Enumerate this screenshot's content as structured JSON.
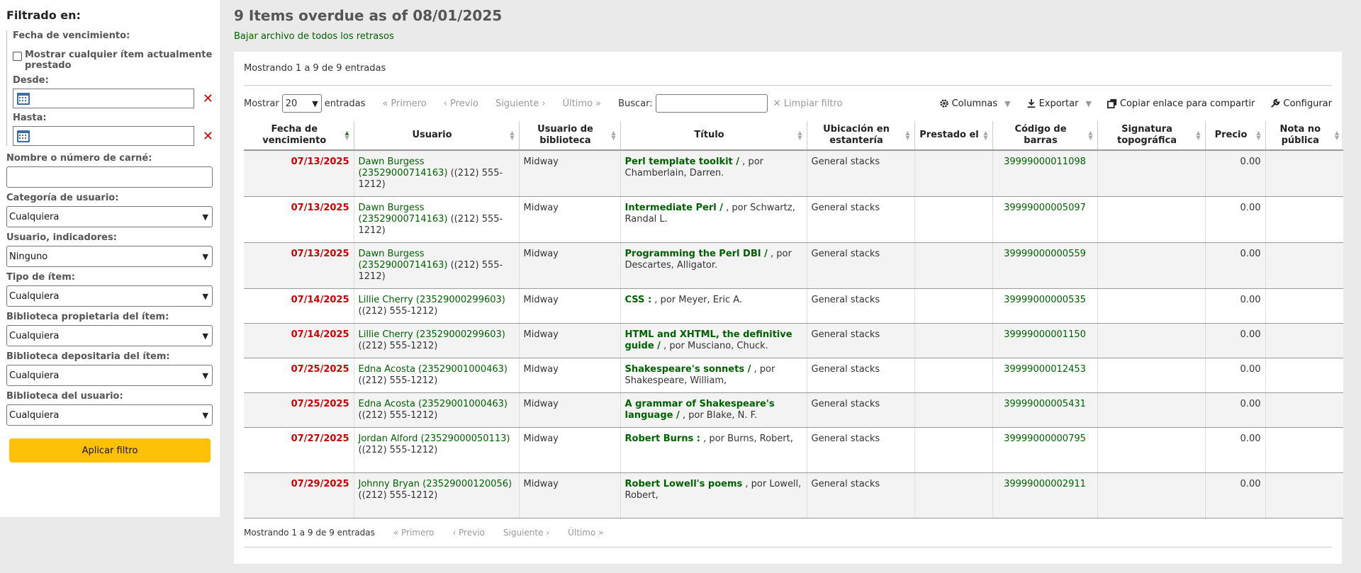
{
  "sidebar": {
    "heading": "Filtrado en:",
    "due_date_label": "Fecha de vencimiento:",
    "show_any_label": "Mostrar cualquier ítem actualmente prestado",
    "from_label": "Desde:",
    "to_label": "Hasta:",
    "patron_label": "Nombre o número de carné:",
    "patron_category_label": "Categoría de usuario:",
    "patron_category_value": "Cualquiera",
    "patron_flags_label": "Usuario, indicadores:",
    "patron_flags_value": "Ninguno",
    "item_type_label": "Tipo de ítem:",
    "item_type_value": "Cualquiera",
    "home_library_label": "Biblioteca propietaria del ítem:",
    "home_library_value": "Cualquiera",
    "holding_library_label": "Biblioteca depositaria del ítem:",
    "holding_library_value": "Cualquiera",
    "patron_library_label": "Biblioteca del usuario:",
    "patron_library_value": "Cualquiera",
    "apply_button": "Aplicar filtro"
  },
  "main": {
    "title": "9 Items overdue as of 08/01/2025",
    "download_link": "Bajar archivo de todos los retrasos",
    "info_top": "Mostrando 1 a 9 de 9 entradas",
    "show_label": "Mostrar",
    "page_size": "20",
    "entries_label": "entradas",
    "first": "« Primero",
    "prev": "‹ Previo",
    "next": "Siguiente ›",
    "last": "Último »",
    "search_label": "Buscar:",
    "clear_filter": "Limpiar filtro",
    "columns_btn": "Columnas",
    "export_btn": "Exportar",
    "copy_link_btn": "Copiar enlace para compartir",
    "configure_btn": "Configurar",
    "info_bottom": "Mostrando 1 a 9 de 9 entradas",
    "columns": [
      "Fecha de vencimiento",
      "Usuario",
      "Usuario de biblioteca",
      "Título",
      "Ubicación en estantería",
      "Prestado el",
      "Código de barras",
      "Signatura topográfica",
      "Precio",
      "Nota no pública"
    ],
    "rows": [
      {
        "due": "07/13/2025",
        "patron": "Dawn Burgess (23529000714163)",
        "phone": "((212) 555-1212)",
        "library": "Midway",
        "title": "Perl template toolkit /",
        "author": ", por Chamberlain, Darren.",
        "location": "General stacks",
        "checked_out": "",
        "barcode": "39999000011098",
        "callnumber": "",
        "price": "0.00",
        "note": ""
      },
      {
        "due": "07/13/2025",
        "patron": "Dawn Burgess (23529000714163)",
        "phone": "((212) 555-1212)",
        "library": "Midway",
        "title": "Intermediate Perl /",
        "author": ", por Schwartz, Randal L.",
        "location": "General stacks",
        "checked_out": "",
        "barcode": "39999000005097",
        "callnumber": "",
        "price": "0.00",
        "note": ""
      },
      {
        "due": "07/13/2025",
        "patron": "Dawn Burgess (23529000714163)",
        "phone": "((212) 555-1212)",
        "library": "Midway",
        "title": "Programming the Perl DBI /",
        "author": ", por Descartes, Alligator.",
        "location": "General stacks",
        "checked_out": "",
        "barcode": "39999000000559",
        "callnumber": "",
        "price": "0.00",
        "note": ""
      },
      {
        "due": "07/14/2025",
        "patron": "Lillie Cherry (23529000299603)",
        "phone": "((212) 555-1212)",
        "library": "Midway",
        "title": "CSS :",
        "author": ", por Meyer, Eric A.",
        "location": "General stacks",
        "checked_out": "",
        "barcode": "39999000000535",
        "callnumber": "",
        "price": "0.00",
        "note": ""
      },
      {
        "due": "07/14/2025",
        "patron": "Lillie Cherry (23529000299603)",
        "phone": "((212) 555-1212)",
        "library": "Midway",
        "title": "HTML and XHTML, the definitive guide /",
        "author": ", por Musciano, Chuck.",
        "location": "General stacks",
        "checked_out": "",
        "barcode": "39999000001150",
        "callnumber": "",
        "price": "0.00",
        "note": ""
      },
      {
        "due": "07/25/2025",
        "patron": "Edna Acosta (23529001000463)",
        "phone": "((212) 555-1212)",
        "library": "Midway",
        "title": "Shakespeare's sonnets /",
        "author": ", por Shakespeare, William,",
        "location": "General stacks",
        "checked_out": "",
        "barcode": "39999000012453",
        "callnumber": "",
        "price": "0.00",
        "note": ""
      },
      {
        "due": "07/25/2025",
        "patron": "Edna Acosta (23529001000463)",
        "phone": "((212) 555-1212)",
        "library": "Midway",
        "title": "A grammar of Shakespeare's language /",
        "author": ", por Blake, N. F.",
        "location": "General stacks",
        "checked_out": "",
        "barcode": "39999000005431",
        "callnumber": "",
        "price": "0.00",
        "note": ""
      },
      {
        "due": "07/27/2025",
        "patron": "Jordan Alford (23529000050113)",
        "phone": "((212) 555-1212)",
        "library": "Midway",
        "title": "Robert Burns :",
        "author": ", por Burns, Robert,",
        "location": "General stacks",
        "checked_out": "",
        "barcode": "39999000000795",
        "callnumber": "",
        "price": "0.00",
        "note": ""
      },
      {
        "due": "07/29/2025",
        "patron": "Johnny Bryan (23529000120056)",
        "phone": "((212) 555-1212)",
        "library": "Midway",
        "title": "Robert Lowell's poems",
        "author": ", por Lowell, Robert,",
        "location": "General stacks",
        "checked_out": "",
        "barcode": "39999000002911",
        "callnumber": "",
        "price": "0.00",
        "note": ""
      }
    ]
  },
  "colors": {
    "link": "#006100",
    "due": "#cc0000",
    "apply": "#ffc107"
  }
}
